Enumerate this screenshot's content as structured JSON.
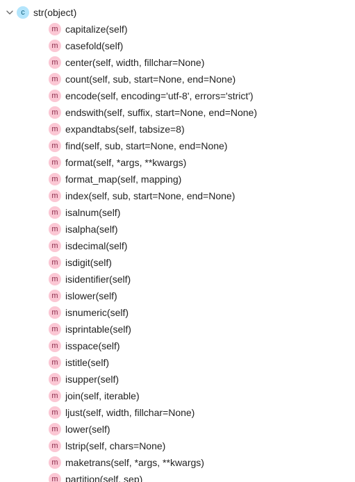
{
  "class": {
    "icon_letter": "c",
    "signature": "str(object)"
  },
  "method_icon_letter": "m",
  "methods": [
    {
      "signature": "capitalize(self)"
    },
    {
      "signature": "casefold(self)"
    },
    {
      "signature": "center(self, width, fillchar=None)"
    },
    {
      "signature": "count(self, sub, start=None, end=None)"
    },
    {
      "signature": "encode(self, encoding='utf-8', errors='strict')"
    },
    {
      "signature": "endswith(self, suffix, start=None, end=None)"
    },
    {
      "signature": "expandtabs(self, tabsize=8)"
    },
    {
      "signature": "find(self, sub, start=None, end=None)"
    },
    {
      "signature": "format(self, *args, **kwargs)"
    },
    {
      "signature": "format_map(self, mapping)"
    },
    {
      "signature": "index(self, sub, start=None, end=None)"
    },
    {
      "signature": "isalnum(self)"
    },
    {
      "signature": "isalpha(self)"
    },
    {
      "signature": "isdecimal(self)"
    },
    {
      "signature": "isdigit(self)"
    },
    {
      "signature": "isidentifier(self)"
    },
    {
      "signature": "islower(self)"
    },
    {
      "signature": "isnumeric(self)"
    },
    {
      "signature": "isprintable(self)"
    },
    {
      "signature": "isspace(self)"
    },
    {
      "signature": "istitle(self)"
    },
    {
      "signature": "isupper(self)"
    },
    {
      "signature": "join(self, iterable)"
    },
    {
      "signature": "ljust(self, width, fillchar=None)"
    },
    {
      "signature": "lower(self)"
    },
    {
      "signature": "lstrip(self, chars=None)"
    },
    {
      "signature": "maketrans(self, *args, **kwargs)"
    },
    {
      "signature": "partition(self, sep)"
    }
  ]
}
